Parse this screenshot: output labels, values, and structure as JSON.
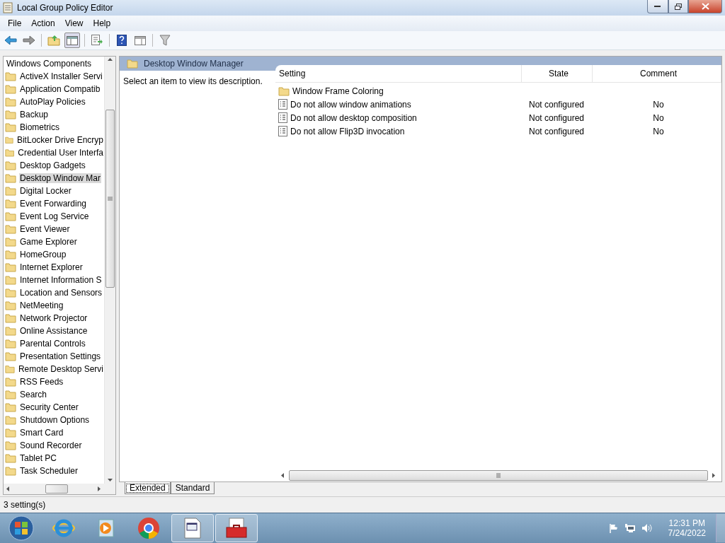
{
  "window": {
    "title": "Local Group Policy Editor"
  },
  "menu": [
    "File",
    "Action",
    "View",
    "Help"
  ],
  "tree": [
    {
      "label": "Windows Components",
      "selected": false,
      "children": [
        {
          "label": "ActiveX Installer Servi",
          "selected": false
        },
        {
          "label": "Application Compatib",
          "selected": false
        },
        {
          "label": "AutoPlay Policies",
          "selected": false
        },
        {
          "label": "Backup",
          "selected": false
        },
        {
          "label": "Biometrics",
          "selected": false
        },
        {
          "label": "BitLocker Drive Encryp",
          "selected": false
        },
        {
          "label": "Credential User Interfa",
          "selected": false
        },
        {
          "label": "Desktop Gadgets",
          "selected": false
        },
        {
          "label": "Desktop Window Mar",
          "selected": true
        },
        {
          "label": "Digital Locker",
          "selected": false
        },
        {
          "label": "Event Forwarding",
          "selected": false
        },
        {
          "label": "Event Log Service",
          "selected": false
        },
        {
          "label": "Event Viewer",
          "selected": false
        },
        {
          "label": "Game Explorer",
          "selected": false
        },
        {
          "label": "HomeGroup",
          "selected": false
        },
        {
          "label": "Internet Explorer",
          "selected": false
        },
        {
          "label": "Internet Information S",
          "selected": false
        },
        {
          "label": "Location and Sensors",
          "selected": false
        },
        {
          "label": "NetMeeting",
          "selected": false
        },
        {
          "label": "Network Projector",
          "selected": false
        },
        {
          "label": "Online Assistance",
          "selected": false
        },
        {
          "label": "Parental Controls",
          "selected": false
        },
        {
          "label": "Presentation Settings",
          "selected": false
        },
        {
          "label": "Remote Desktop Servi",
          "selected": false
        },
        {
          "label": "RSS Feeds",
          "selected": false
        },
        {
          "label": "Search",
          "selected": false
        },
        {
          "label": "Security Center",
          "selected": false
        },
        {
          "label": "Shutdown Options",
          "selected": false
        },
        {
          "label": "Smart Card",
          "selected": false
        },
        {
          "label": "Sound Recorder",
          "selected": false
        },
        {
          "label": "Tablet PC",
          "selected": false
        },
        {
          "label": "Task Scheduler",
          "selected": false
        }
      ]
    }
  ],
  "details": {
    "header": "Desktop Window Manager",
    "description": "Select an item to view its description.",
    "columns": [
      "Setting",
      "State",
      "Comment"
    ],
    "rows": [
      {
        "kind": "folder",
        "setting": "Window Frame Coloring"
      },
      {
        "kind": "policy",
        "setting": "Do not allow window animations",
        "state": "Not configured",
        "comment": "No"
      },
      {
        "kind": "policy",
        "setting": "Do not allow desktop composition",
        "state": "Not configured",
        "comment": "No"
      },
      {
        "kind": "policy",
        "setting": "Do not allow Flip3D invocation",
        "state": "Not configured",
        "comment": "No"
      }
    ]
  },
  "view_tabs": [
    {
      "label": "Extended",
      "selected": true
    },
    {
      "label": "Standard",
      "selected": false
    }
  ],
  "status_bar": "3 setting(s)",
  "clock": {
    "time": "12:31 PM",
    "date": "7/24/2022"
  }
}
